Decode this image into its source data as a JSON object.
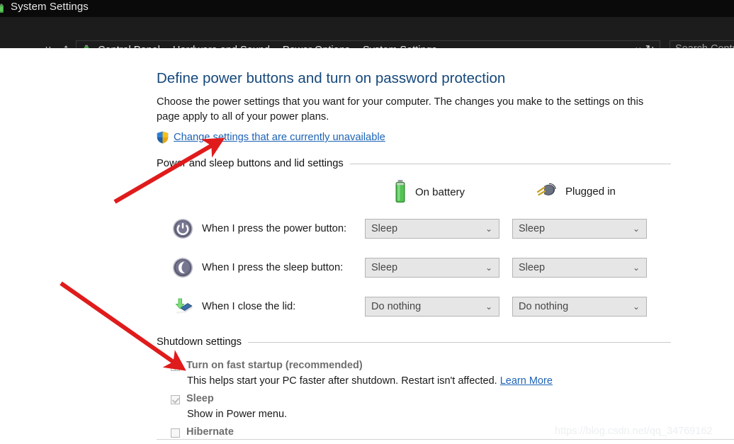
{
  "window": {
    "title": "System Settings",
    "icon": "power-options-icon"
  },
  "navbar": {
    "back_icon": "back-arrow-icon",
    "forward_icon": "forward-arrow-icon",
    "recent_icon": "chevron-down-icon",
    "up_icon": "up-arrow-icon",
    "breadcrumb_icon": "power-options-icon",
    "breadcrumb": [
      "Control Panel",
      "Hardware and Sound",
      "Power Options",
      "System Settings"
    ],
    "separator": "›",
    "dropdown_icon": "chevron-down-icon",
    "refresh_icon": "refresh-icon",
    "refresh_glyph": "↻",
    "search_placeholder": "Search Control Panel"
  },
  "page": {
    "heading": "Define power buttons and turn on password protection",
    "description": "Choose the power settings that you want for your computer. The changes you make to the settings on this page apply to all of your power plans.",
    "uac_link": "Change settings that are currently unavailable",
    "uac_icon": "shield-icon"
  },
  "groups": {
    "power_and_sleep": "Power and sleep buttons and lid settings",
    "shutdown": "Shutdown settings"
  },
  "columns": [
    {
      "label": "On battery",
      "icon": "battery-icon"
    },
    {
      "label": "Plugged in",
      "icon": "power-plug-icon"
    }
  ],
  "settings_rows": [
    {
      "icon": "power-button-icon",
      "label": "When I press the power button:",
      "on_battery": "Sleep",
      "plugged_in": "Sleep"
    },
    {
      "icon": "sleep-button-icon",
      "label": "When I press the sleep button:",
      "on_battery": "Sleep",
      "plugged_in": "Sleep"
    },
    {
      "icon": "laptop-lid-icon",
      "label": "When I close the lid:",
      "on_battery": "Do nothing",
      "plugged_in": "Do nothing"
    }
  ],
  "combo_arrow": "⌄",
  "shutdown_options": [
    {
      "label": "Turn on fast startup (recommended)",
      "checked": true,
      "disabled": true,
      "description": "This helps start your PC faster after shutdown. Restart isn't affected.",
      "link": "Learn More"
    },
    {
      "label": "Sleep",
      "checked": true,
      "disabled": true,
      "description": "Show in Power menu.",
      "link": ""
    },
    {
      "label": "Hibernate",
      "checked": false,
      "disabled": true,
      "description": "",
      "link": ""
    }
  ],
  "watermark": "https://blog.csdn.net/qq_34769162",
  "annotations": {
    "arrow_color": "#e01b1b",
    "arrow_1_target": "change-settings-link",
    "arrow_2_target": "fast-startup-checkbox"
  },
  "colors": {
    "titlebar_bg": "#0a0a0a",
    "navbar_bg": "#1c1c1c",
    "heading": "#16487a",
    "link": "#1d63b5",
    "content_bg": "#ffffff"
  }
}
